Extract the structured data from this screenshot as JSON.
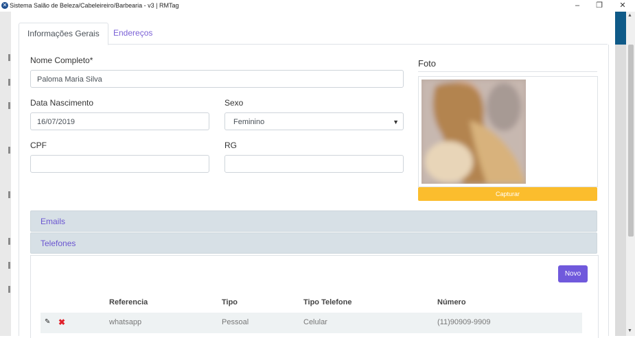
{
  "window": {
    "title": "Sistema Salão de Beleza/Cabeleireiro/Barbearia - v3 | RMTag",
    "minimize": "‒",
    "maximize": "❐",
    "close": "✕"
  },
  "tabs": [
    {
      "label": "Informações Gerais",
      "active": true
    },
    {
      "label": "Endereços",
      "active": false
    }
  ],
  "form": {
    "nome_label": "Nome Completo*",
    "nome_value": "Paloma Maria Silva",
    "nascimento_label": "Data Nascimento",
    "nascimento_value": "16/07/2019",
    "sexo_label": "Sexo",
    "sexo_value": "Feminino",
    "cpf_label": "CPF",
    "cpf_value": "",
    "rg_label": "RG",
    "rg_value": ""
  },
  "foto": {
    "title": "Foto",
    "capture_label": "Capturar"
  },
  "accordion": {
    "emails_label": "Emails",
    "telefones_label": "Telefones"
  },
  "telefones": {
    "novo_label": "Novo",
    "columns": [
      "Referencia",
      "Tipo",
      "Tipo Telefone",
      "Número"
    ],
    "rows": [
      {
        "referencia": "whatsapp",
        "tipo": "Pessoal",
        "tipo_telefone": "Celular",
        "numero": "(11)90909-9909"
      }
    ]
  },
  "colors": {
    "accent": "#7059dc",
    "capture": "#fbbd2d",
    "delete": "#e0202a",
    "accordion_bg": "#d7e0e6"
  }
}
